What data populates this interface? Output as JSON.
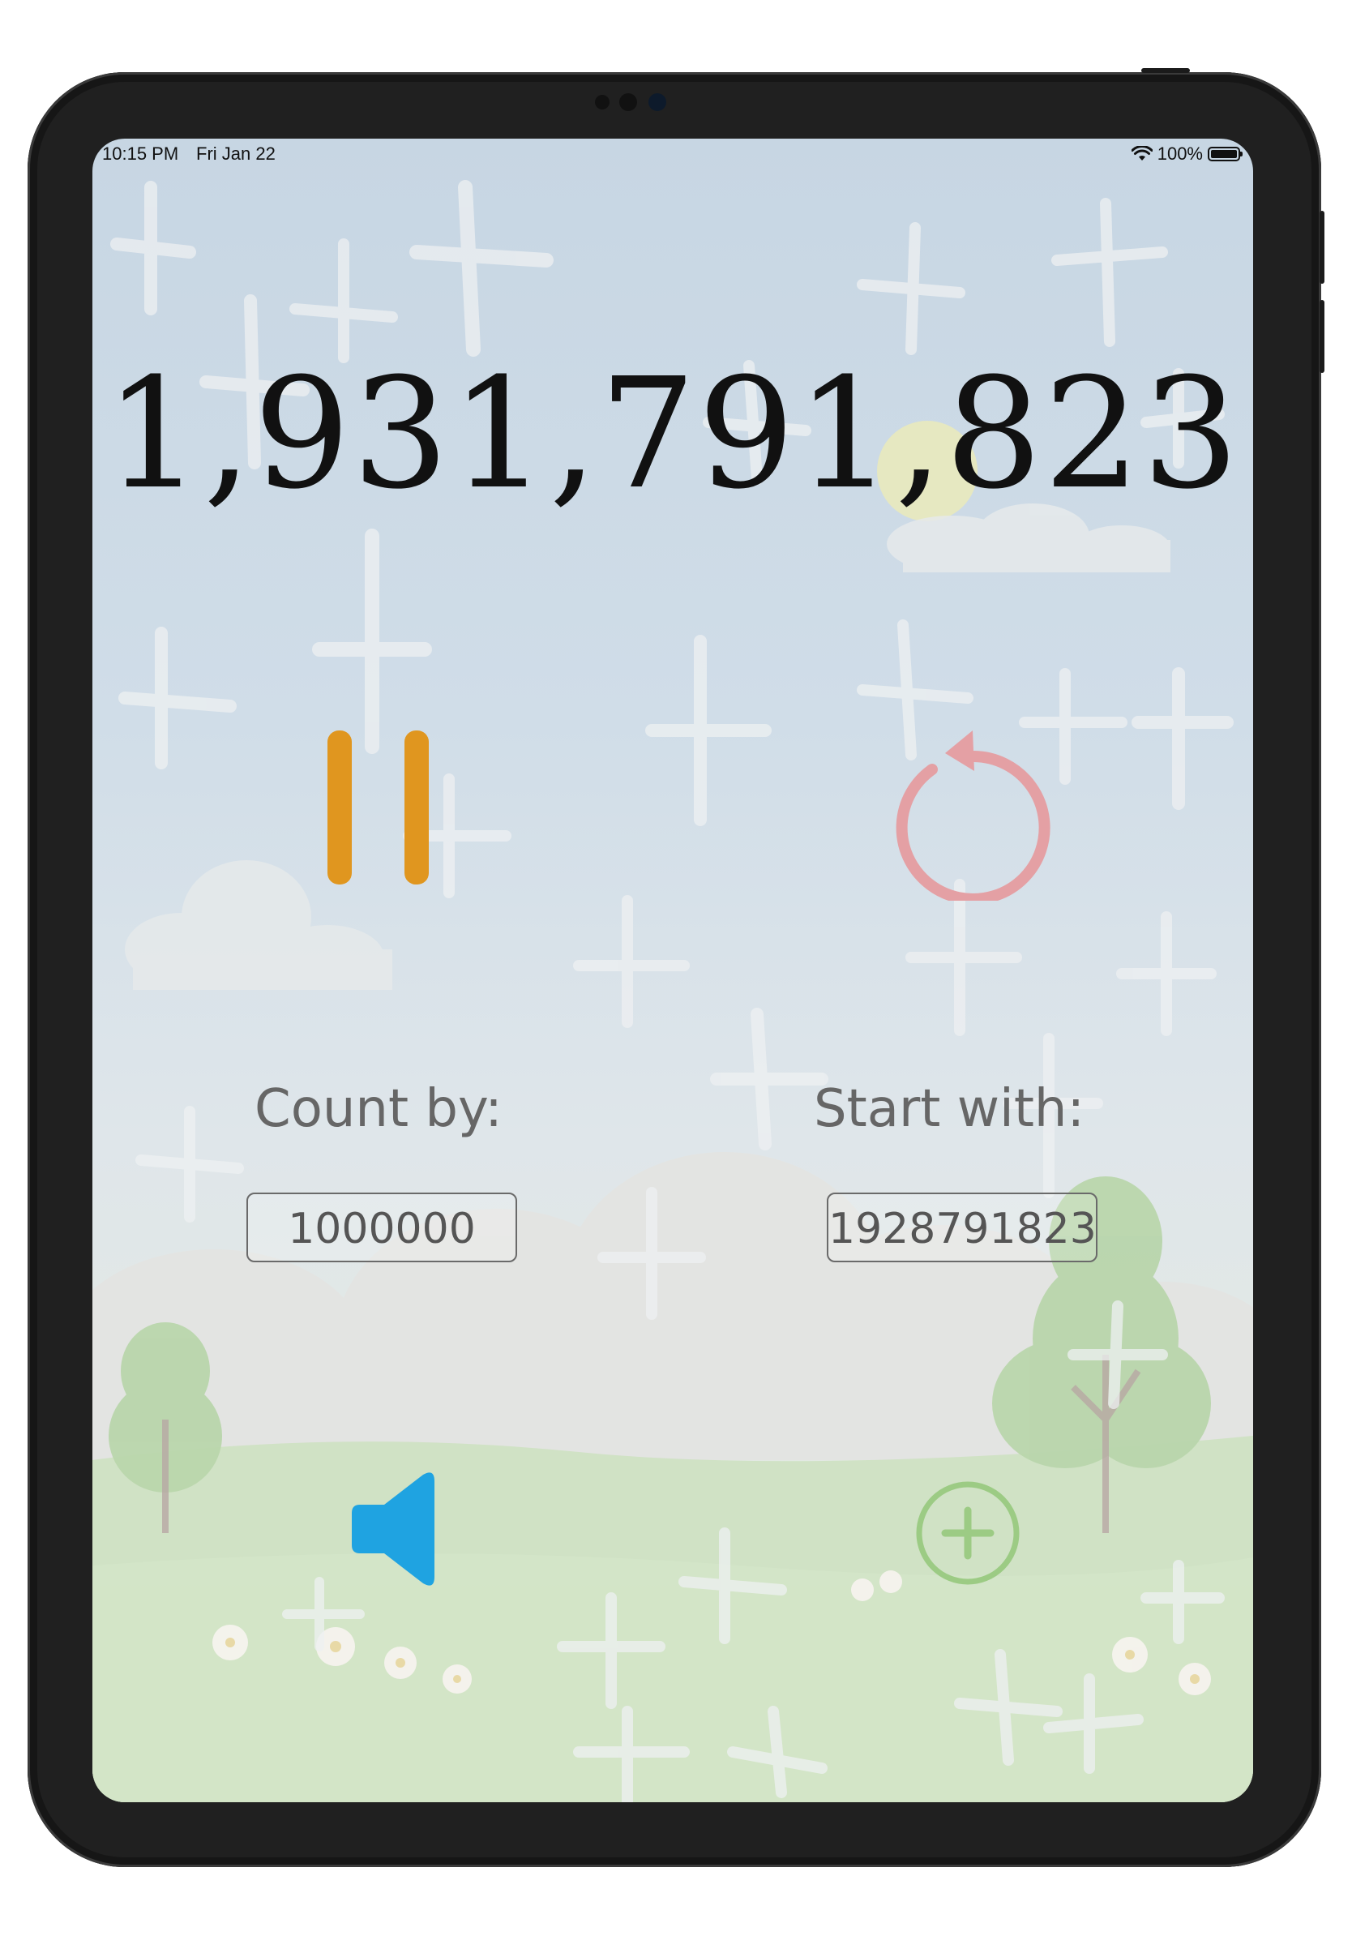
{
  "status_bar": {
    "time": "10:15 PM",
    "date": "Fri Jan 22",
    "battery_percent": "100%",
    "wifi_icon": "wifi-icon",
    "battery_icon": "battery-icon"
  },
  "counter": {
    "value": "1,931,791,823"
  },
  "controls": {
    "pause_icon": "pause-icon",
    "reset_icon": "reset-icon",
    "sound_icon": "speaker-icon",
    "add_icon": "plus-circle-icon"
  },
  "settings": {
    "count_by_label": "Count by:",
    "count_by_value": "1000000",
    "start_with_label": "Start with:",
    "start_with_value": "1928791823"
  },
  "colors": {
    "pause": "#E0961F",
    "reset": "#E4A0A4",
    "sound": "#1FA3E1",
    "add": "#9CCB84"
  }
}
